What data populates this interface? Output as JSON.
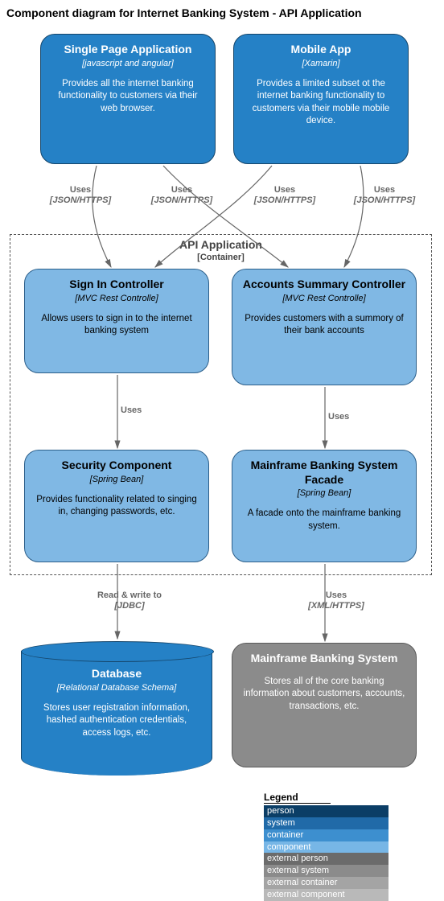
{
  "title": "Component diagram for Internet Banking System - API Application",
  "containers": {
    "api": {
      "label": "API Application",
      "sub": "[Container]"
    }
  },
  "nodes": {
    "spa": {
      "title": "Single Page Application",
      "sub": "[javascript and angular]",
      "desc": "Provides all the internet banking functionality to customers via their web browser."
    },
    "mobile": {
      "title": "Mobile App",
      "sub": "[Xamarin]",
      "desc": "Provides a limited subset ot the internet banking functionality to customers via their mobile mobile device."
    },
    "signin": {
      "title": "Sign In Controller",
      "sub": "[MVC Rest Controlle]",
      "desc": "Allows users to sign in to the internet banking system"
    },
    "accounts": {
      "title": "Accounts Summary Controller",
      "sub": "[MVC Rest Controlle]",
      "desc": "Provides customers with a summory of their bank accounts"
    },
    "security": {
      "title": "Security Component",
      "sub": "[Spring Bean]",
      "desc": "Provides functionality related to singing in, changing passwords, etc."
    },
    "facade": {
      "title": "Mainframe Banking System Facade",
      "sub": "[Spring Bean]",
      "desc": "A facade onto the mainframe banking system."
    },
    "database": {
      "title": "Database",
      "sub": "[Relational Database Schema]",
      "desc": "Stores user registration information, hashed authentication credentials, access logs, etc."
    },
    "mainframe": {
      "title": "Mainframe Banking System",
      "desc": "Stores all of the core banking information about customers, accounts, transactions, etc."
    }
  },
  "edges": {
    "uses_jh1": {
      "label": "Uses",
      "sub": "[JSON/HTTPS]"
    },
    "uses_jh2": {
      "label": "Uses",
      "sub": "[JSON/HTTPS]"
    },
    "uses_jh3": {
      "label": "Uses",
      "sub": "[JSON/HTTPS]"
    },
    "uses_jh4": {
      "label": "Uses",
      "sub": "[JSON/HTTPS]"
    },
    "uses_plain1": {
      "label": "Uses"
    },
    "uses_plain2": {
      "label": "Uses"
    },
    "rw": {
      "label": "Read & write to",
      "sub": "[JDBC]"
    },
    "uses_xml": {
      "label": "Uses",
      "sub": "[XML/HTTPS]"
    }
  },
  "legend": {
    "title": "Legend",
    "rows": [
      {
        "label": "person",
        "color": "#0b3e66"
      },
      {
        "label": "system",
        "color": "#206aa8"
      },
      {
        "label": "container",
        "color": "#3d8fcf"
      },
      {
        "label": "component",
        "color": "#77b6e6"
      },
      {
        "label": "external person",
        "color": "#6b6b6b"
      },
      {
        "label": "external system",
        "color": "#8b8b8b"
      },
      {
        "label": "external container",
        "color": "#a4a4a4"
      },
      {
        "label": "external component",
        "color": "#b9b9b9"
      }
    ]
  }
}
